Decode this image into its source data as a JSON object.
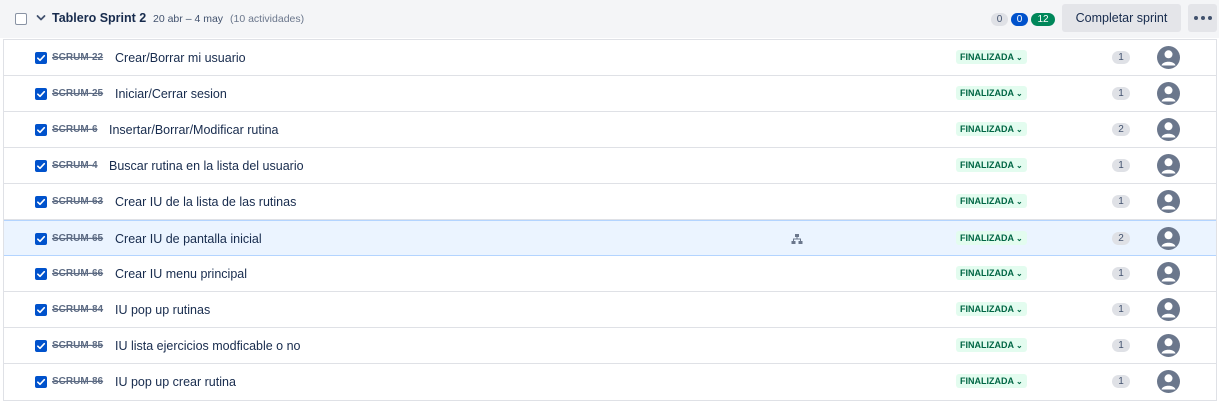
{
  "sprint": {
    "title": "Tablero Sprint 2",
    "dates": "20 abr – 4 may",
    "activity_count": "(10 actividades)",
    "counts": {
      "todo": "0",
      "in_progress": "0",
      "done": "12"
    },
    "complete_label": "Completar sprint",
    "colors": {
      "todo": "#dfe1e6",
      "in_progress": "#0052cc",
      "done": "#00875a",
      "status_bg": "#e3fcef",
      "status_text": "#006644"
    }
  },
  "issues": [
    {
      "key": "SCRUM-22",
      "summary": "Crear/Borrar mi usuario",
      "status": "FINALIZADA",
      "points": "1",
      "checked": true
    },
    {
      "key": "SCRUM-25",
      "summary": "Iniciar/Cerrar sesion",
      "status": "FINALIZADA",
      "points": "1",
      "checked": true
    },
    {
      "key": "SCRUM-6",
      "summary": "Insertar/Borrar/Modificar rutina",
      "status": "FINALIZADA",
      "points": "2",
      "checked": true
    },
    {
      "key": "SCRUM-4",
      "summary": "Buscar rutina en la lista del usuario",
      "status": "FINALIZADA",
      "points": "1",
      "checked": true
    },
    {
      "key": "SCRUM-63",
      "summary": "Crear IU de la lista de las rutinas",
      "status": "FINALIZADA",
      "points": "1",
      "checked": true
    },
    {
      "key": "SCRUM-65",
      "summary": "Crear IU de pantalla inicial",
      "status": "FINALIZADA",
      "points": "2",
      "checked": true,
      "selected": true,
      "child_issues_icon": "hierarchy-icon"
    },
    {
      "key": "SCRUM-66",
      "summary": "Crear IU menu principal",
      "status": "FINALIZADA",
      "points": "1",
      "checked": true
    },
    {
      "key": "SCRUM-84",
      "summary": "IU pop up rutinas",
      "status": "FINALIZADA",
      "points": "1",
      "checked": true
    },
    {
      "key": "SCRUM-85",
      "summary": "IU lista ejercicios modficable o no",
      "status": "FINALIZADA",
      "points": "1",
      "checked": true
    },
    {
      "key": "SCRUM-86",
      "summary": "IU pop up crear rutina",
      "status": "FINALIZADA",
      "points": "1",
      "checked": true
    }
  ]
}
